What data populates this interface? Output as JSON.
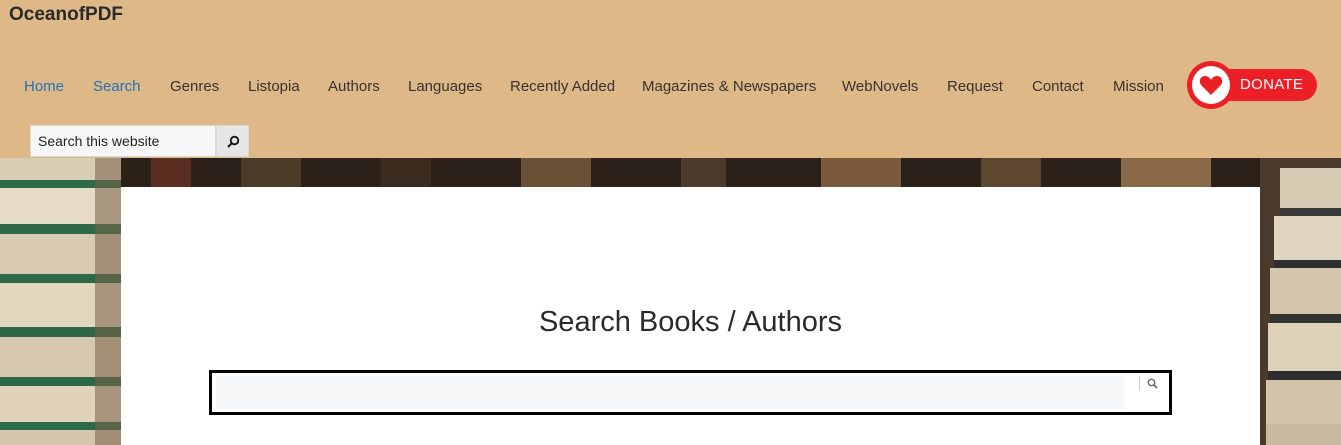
{
  "site": {
    "title": "OceanofPDF"
  },
  "nav": {
    "items": [
      {
        "label": "Home",
        "active": true
      },
      {
        "label": "Search",
        "active": true
      },
      {
        "label": "Genres",
        "active": false
      },
      {
        "label": "Listopia",
        "active": false
      },
      {
        "label": "Authors",
        "active": false
      },
      {
        "label": "Languages",
        "active": false
      },
      {
        "label": "Recently Added",
        "active": false
      },
      {
        "label": "Magazines & Newspapers",
        "active": false
      },
      {
        "label": "WebNovels",
        "active": false
      },
      {
        "label": "Request",
        "active": false
      },
      {
        "label": "Contact",
        "active": false
      },
      {
        "label": "Mission",
        "active": false
      }
    ]
  },
  "donate": {
    "label": "DONATE",
    "icon": "heart-icon"
  },
  "site_search": {
    "placeholder": "Search this website",
    "value": "",
    "icon": "search-icon"
  },
  "main": {
    "title": "Search Books / Authors",
    "search": {
      "value": "",
      "placeholder": "",
      "icon": "search-icon"
    }
  },
  "colors": {
    "header_bg": "#deb887",
    "link_active": "#1e73be",
    "donate_red": "#ec1f26"
  }
}
